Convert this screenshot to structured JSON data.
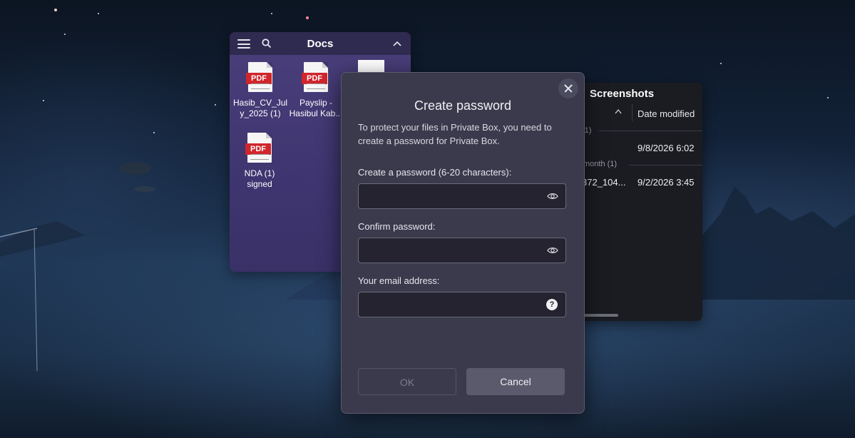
{
  "docs_panel": {
    "title": "Docs",
    "files": [
      {
        "icon": "pdf-file-icon",
        "badge": "PDF",
        "name_line1": "Hasib_CV_Jul",
        "name_line2": "y_2025 (1)"
      },
      {
        "icon": "pdf-file-icon",
        "badge": "PDF",
        "name_line1": "Payslip -",
        "name_line2": "Hasibul Kab..."
      },
      {
        "icon": "pdf-file-icon",
        "badge": "PDF",
        "name_line1": "NDA (1)",
        "name_line2": "signed"
      }
    ]
  },
  "screenshots_panel": {
    "title": "Screenshots",
    "column_date": "Date modified",
    "group1": "(1)",
    "row1_date": "9/8/2026 6:02",
    "group2": "month (1)",
    "row2_name": "372_104...",
    "row2_date": "9/2/2026 3:45"
  },
  "dialog": {
    "title": "Create password",
    "description": "To protect your files in Private Box, you need to create a password for Private Box.",
    "password_label": "Create a password (6-20 characters):",
    "password_value": "",
    "confirm_label": "Confirm password:",
    "confirm_value": "",
    "email_label": "Your email address:",
    "email_value": "",
    "help_glyph": "?",
    "ok_label": "OK",
    "cancel_label": "Cancel"
  },
  "colors": {
    "docs_bg": "#3f3570",
    "dialog_bg": "#3a3a4c",
    "pdf_badge": "#d0262c",
    "cancel_button": "#5a5a6c"
  }
}
